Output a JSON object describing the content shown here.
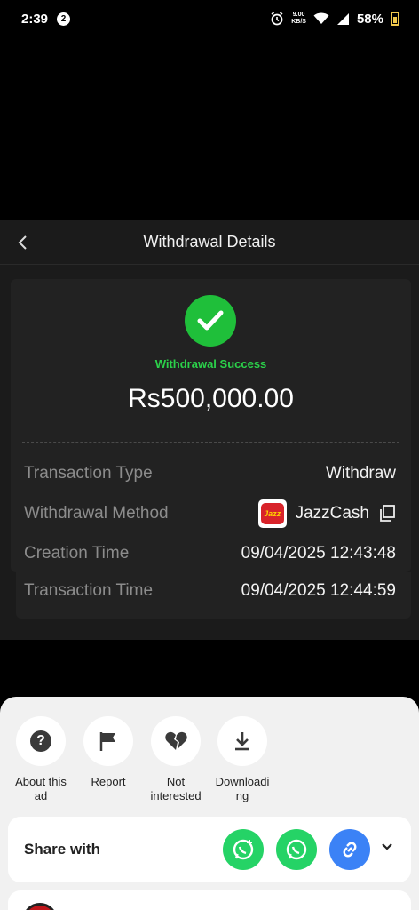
{
  "status_bar": {
    "time": "2:39",
    "notification_count": "2",
    "net_speed_value": "9.00",
    "net_speed_unit": "KB/S",
    "battery": "58%"
  },
  "header": {
    "title": "Withdrawal Details"
  },
  "summary": {
    "status": "Withdrawal Success",
    "amount": "Rs500,000.00",
    "status_color": "#1fbf3a"
  },
  "details": [
    {
      "label": "Transaction Type",
      "value": "Withdraw"
    },
    {
      "label": "Withdrawal Method",
      "value": "JazzCash",
      "logo_text": "Jazz"
    },
    {
      "label": "Creation Time",
      "value": "09/04/2025 12:43:48"
    },
    {
      "label": "Transaction Time",
      "value": "09/04/2025 12:44:59"
    }
  ],
  "ad_sheet": {
    "actions": [
      {
        "label": "About this\nad",
        "icon": "question-icon"
      },
      {
        "label": "Report",
        "icon": "flag-icon"
      },
      {
        "label": "Not\ninterested",
        "icon": "broken-heart-icon"
      },
      {
        "label": "Downloadi\nng",
        "icon": "download-icon"
      }
    ],
    "share_label": "Share with",
    "share_targets": [
      "whatsapp-business-icon",
      "whatsapp-icon",
      "link-icon"
    ]
  }
}
